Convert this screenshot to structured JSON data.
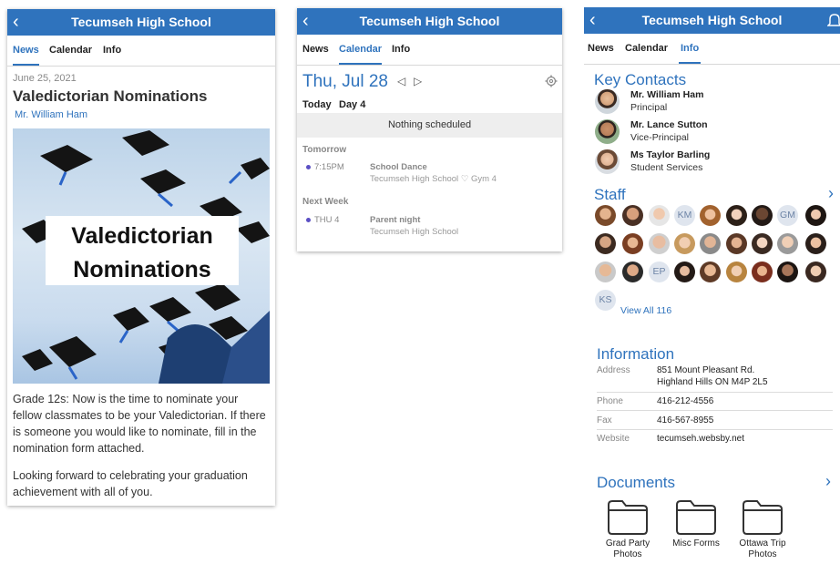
{
  "app": {
    "title": "Tecumseh High School",
    "back_icon": "chevron-left-icon",
    "tabs": [
      "News",
      "Calendar",
      "Info"
    ]
  },
  "news": {
    "date": "June 25, 2021",
    "headline": "Valedictorian Nominations",
    "author": "Mr. William Ham",
    "image_caption_line1": "Valedictorian",
    "image_caption_line2": "Nominations",
    "paragraph1": "Grade 12s: Now is the time to nominate your fellow classmates to be your Valedictorian. If there is someone you would like to nominate, fill in the nomination form attached.",
    "paragraph2": "Looking forward to celebrating your graduation achievement with all of you."
  },
  "calendar": {
    "date": "Thu, Jul 28",
    "today_label": "Today",
    "day_label": "Day 4",
    "nothing": "Nothing scheduled",
    "tomorrow_label": "Tomorrow",
    "event1_time": "7:15PM",
    "event1_title": "School Dance",
    "event1_location": "Tecumseh High School",
    "event1_room": "Gym 4",
    "next_week_label": "Next Week",
    "event2_time": "THU 4",
    "event2_title": "Parent night",
    "event2_location": "Tecumseh High School",
    "accent": "#5b4fc4"
  },
  "info": {
    "key_contacts_title": "Key Contacts",
    "contacts": [
      {
        "name": "Mr. William Ham",
        "role": "Principal"
      },
      {
        "name": "Mr. Lance Sutton",
        "role": "Vice-Principal"
      },
      {
        "name": "Ms Taylor Barling",
        "role": "Student Services"
      }
    ],
    "staff_title": "Staff",
    "staff_initials": [
      "KM",
      "GM",
      "EP",
      "KS"
    ],
    "view_all": "View All 116",
    "information_title": "Information",
    "address_label": "Address",
    "address_line1": "851 Mount Pleasant Rd.",
    "address_line2": "Highland Hills ON M4P 2L5",
    "phone_label": "Phone",
    "phone": "416-212-4556",
    "fax_label": "Fax",
    "fax": "416-567-8955",
    "website_label": "Website",
    "website": "tecumseh.websby.net",
    "documents_title": "Documents",
    "documents": [
      {
        "line1": "Grad Party",
        "line2": "Photos"
      },
      {
        "line1": "Misc Forms",
        "line2": ""
      },
      {
        "line1": "Ottawa Trip",
        "line2": "Photos"
      }
    ]
  },
  "colors": {
    "brand": "#2f73bd",
    "divider": "#d7d7d7"
  }
}
